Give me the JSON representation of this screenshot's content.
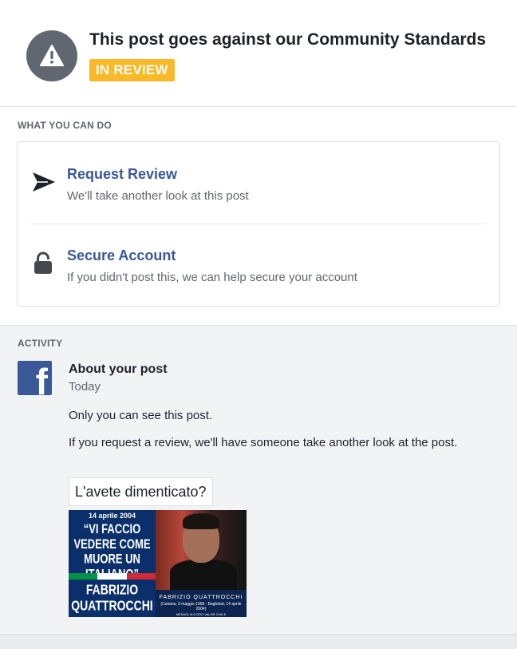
{
  "header": {
    "title": "This post goes against our Community Standards",
    "badge": "IN REVIEW",
    "icon": "warning-icon"
  },
  "what_you_can_do": {
    "label": "WHAT YOU CAN DO",
    "actions": [
      {
        "icon": "send-icon",
        "title": "Request Review",
        "subtitle": "We'll take another look at this post"
      },
      {
        "icon": "lock-icon",
        "title": "Secure Account",
        "subtitle": "If you didn't post this, we can help secure your account"
      }
    ]
  },
  "activity": {
    "label": "ACTIVITY",
    "icon": "facebook-logo",
    "title": "About your post",
    "date": "Today",
    "text1": "Only you can see this post.",
    "text2": "If you request a review, we'll have someone take another look at the post.",
    "post": {
      "caption": "L'avete dimenticato?",
      "image_text": {
        "date": "14 aprile 2004",
        "quote": "“VI FACCIO VEDERE COME MUORE UN ITALIANO”",
        "name": "FABRIZIO QUATTROCCHI",
        "caption_name": "FABRIZIO QUATTROCCHI",
        "caption_dates": "(Catania, 9 maggio 1968 - Baghdad, 14 aprile 2004)",
        "caption_award": "MEDAGLIA D'ORO VALOR CIVILE"
      }
    }
  },
  "colors": {
    "badge": "#f7b928",
    "link": "#385898",
    "facebook": "#3b5998",
    "icon_gray": "#606770"
  }
}
